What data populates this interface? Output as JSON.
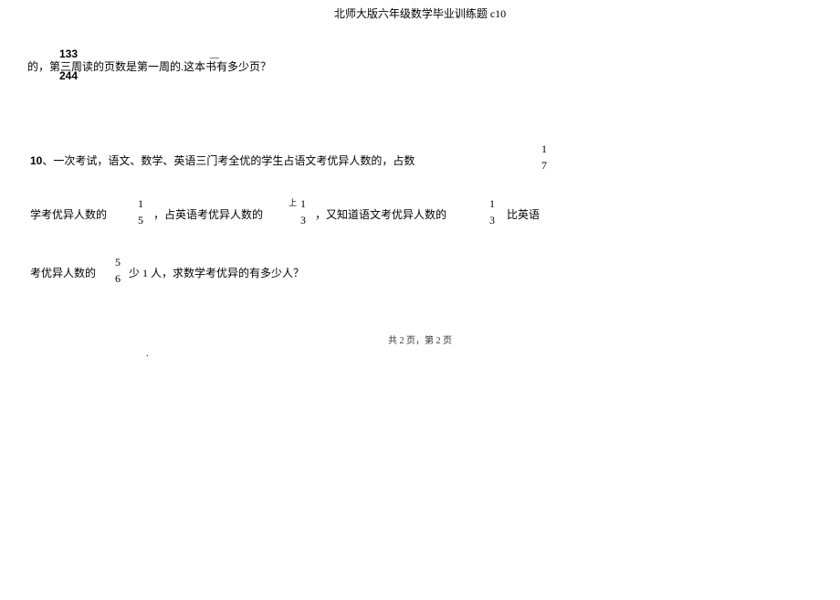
{
  "title": "北师大版六年级数学毕业训练题 c10",
  "q9": {
    "frac_top": "133",
    "mid_text": "的，第三周读的页数是第一周的.这本书有多少页？",
    "frac_bottom": "244",
    "over_mark": "—"
  },
  "q10": {
    "number": "10",
    "row1_text": "、一次考试，语文、数学、英语三门考全优的学生占语文考优异人数的，占数",
    "frac_1_7_n": "1",
    "frac_1_7_d": "7",
    "row2_seg1": "学考优异人数的",
    "frac_1_5_n": "1",
    "frac_1_5_d": "5",
    "row2_seg2": "，占英语考优异人数的",
    "frac_1_3a_n": "1",
    "frac_1_3a_d": "3",
    "frac_1_3a_pre": "上",
    "row2_seg3": "，又知道语文考优异人数的",
    "frac_1_3b_n": "1",
    "frac_1_3b_d": "3",
    "frac_1_3b_pre": "",
    "row2_seg4": "比英语",
    "row3_seg1": "考优异人数的",
    "frac_5_6_n": "5",
    "frac_5_6_d": "6",
    "row3_seg2": "少 1 人，求数学考优异的有多少人？"
  },
  "footer": "共 2 页，第 2 页",
  "dot": "."
}
